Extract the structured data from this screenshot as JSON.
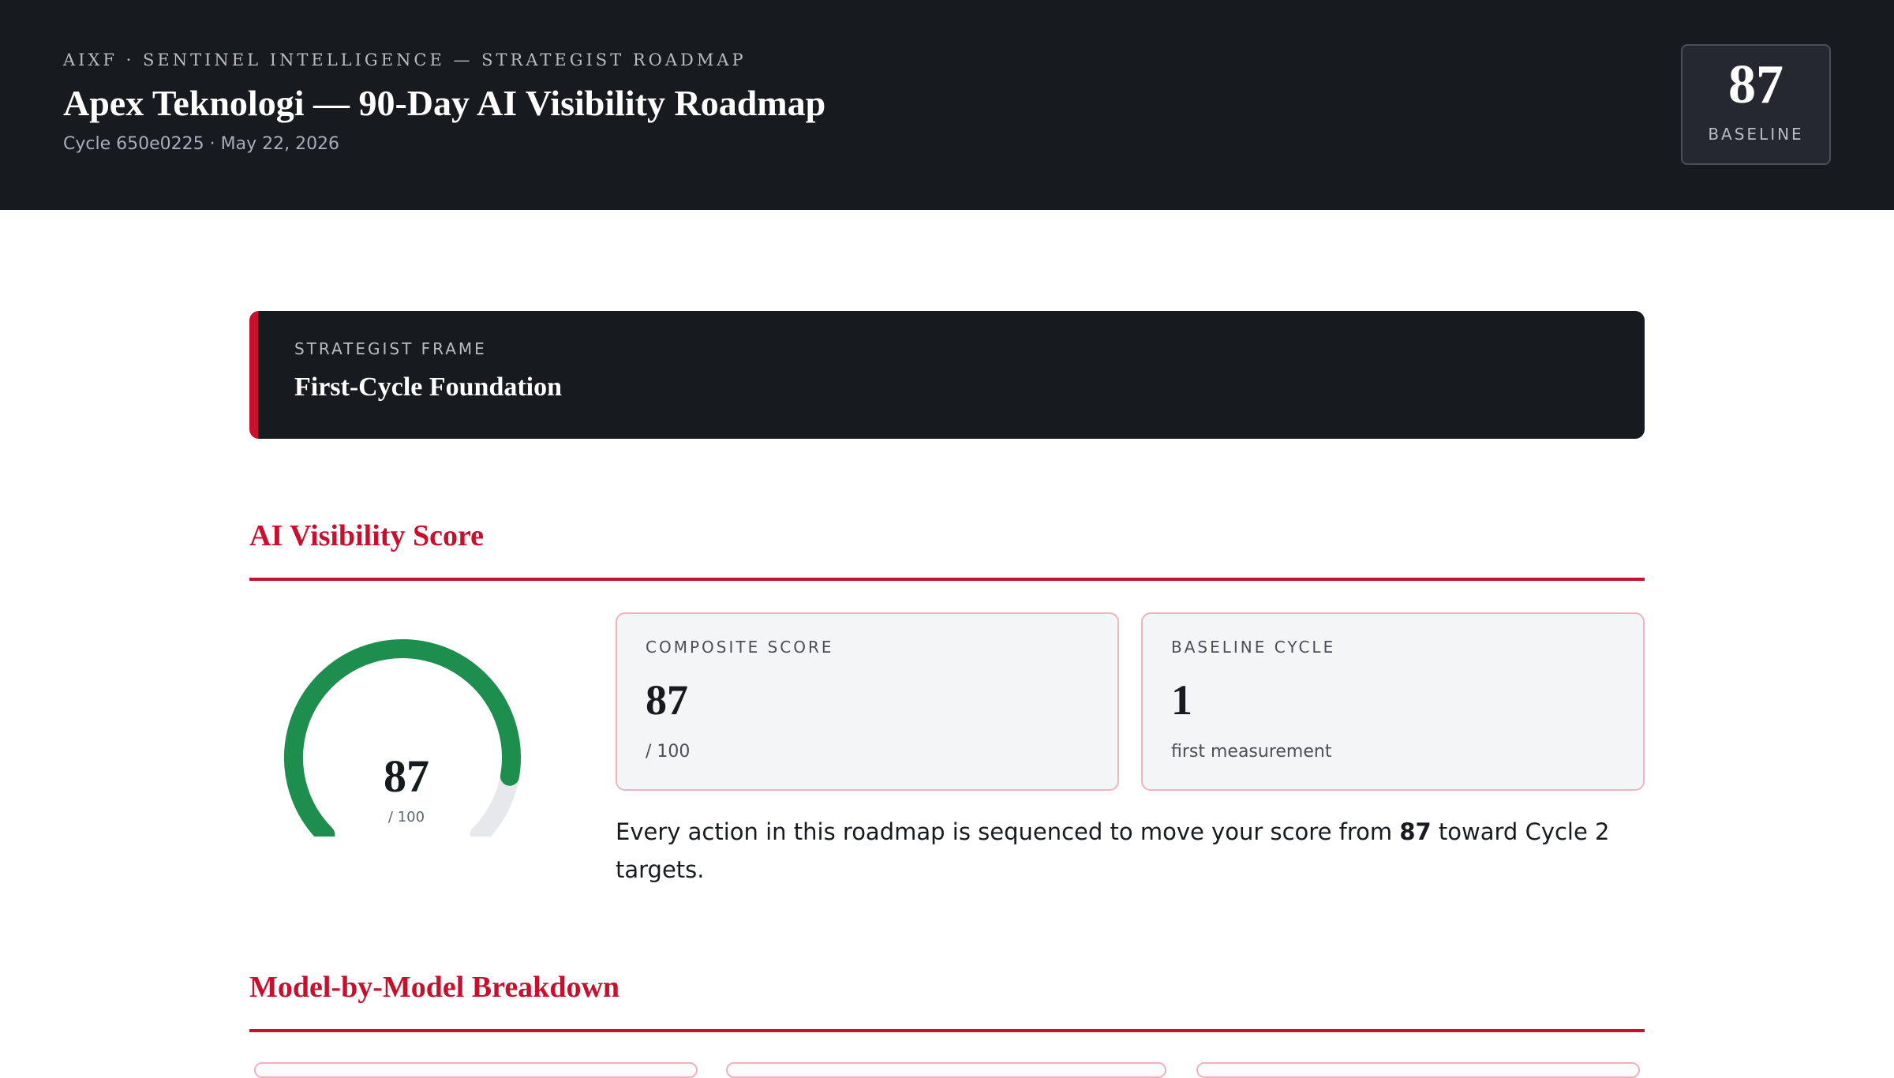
{
  "header": {
    "eyebrow": "AIXF · SENTINEL INTELLIGENCE — STRATEGIST ROADMAP",
    "title": "Apex Teknologi — 90-Day AI Visibility Roadmap",
    "meta": "Cycle 650e0225 · May 22, 2026",
    "baseline_value": "87",
    "baseline_label": "BASELINE"
  },
  "strategist_frame": {
    "eyebrow": "STRATEGIST FRAME",
    "title": "First-Cycle Foundation"
  },
  "sections": {
    "visibility": "AI Visibility Score",
    "models": "Model-by-Model Breakdown"
  },
  "gauge": {
    "value": 87,
    "max": 100,
    "value_text": "87",
    "sub": "/ 100"
  },
  "cards": [
    {
      "label": "COMPOSITE SCORE",
      "value": "87",
      "sub": "/ 100"
    },
    {
      "label": "BASELINE CYCLE",
      "value": "1",
      "sub": "first measurement"
    }
  ],
  "summary": {
    "before": "Every action in this roadmap is sequenced to move your score from ",
    "score": "87",
    "after": " toward Cycle 2 targets."
  },
  "colors": {
    "accent": "#c8102e",
    "dark": "#171a1f",
    "gauge_fill": "#1e8e4e",
    "gauge_track": "#e6e8ec"
  }
}
